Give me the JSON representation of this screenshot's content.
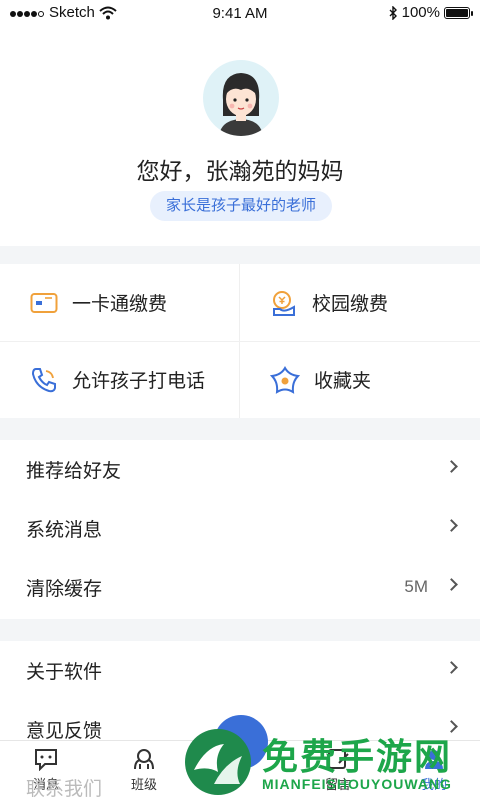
{
  "status_bar": {
    "carrier": "Sketch",
    "time": "9:41 AM",
    "battery": "100%"
  },
  "profile": {
    "greeting": "您好，张瀚苑的妈妈",
    "slogan": "家长是孩子最好的老师"
  },
  "grid": [
    {
      "label": "一卡通缴费",
      "icon": "card-icon"
    },
    {
      "label": "校园缴费",
      "icon": "yuan-coin-icon"
    },
    {
      "label": "允许孩子打电话",
      "icon": "phone-icon"
    },
    {
      "label": "收藏夹",
      "icon": "flower-star-icon"
    }
  ],
  "list1": [
    {
      "label": "推荐给好友"
    },
    {
      "label": "系统消息"
    },
    {
      "label": "清除缓存",
      "value": "5M"
    }
  ],
  "list2": [
    {
      "label": "关于软件"
    },
    {
      "label": "意见反馈"
    }
  ],
  "ghost_row": "联系我们",
  "tabs": [
    {
      "label": "消息",
      "icon": "message-icon"
    },
    {
      "label": "班级",
      "icon": "class-icon"
    },
    {
      "label": "留言",
      "icon": "note-icon"
    },
    {
      "label": "我的",
      "icon": "profile-icon",
      "active": true
    }
  ],
  "watermark": {
    "title": "免费手游网",
    "subtitle": "MIANFEISHOUYOUWANG"
  },
  "colors": {
    "accent": "#3a6fd8",
    "watermark": "#1da64a",
    "icon_orange": "#f0a13b",
    "icon_blue": "#3a6fd8"
  }
}
